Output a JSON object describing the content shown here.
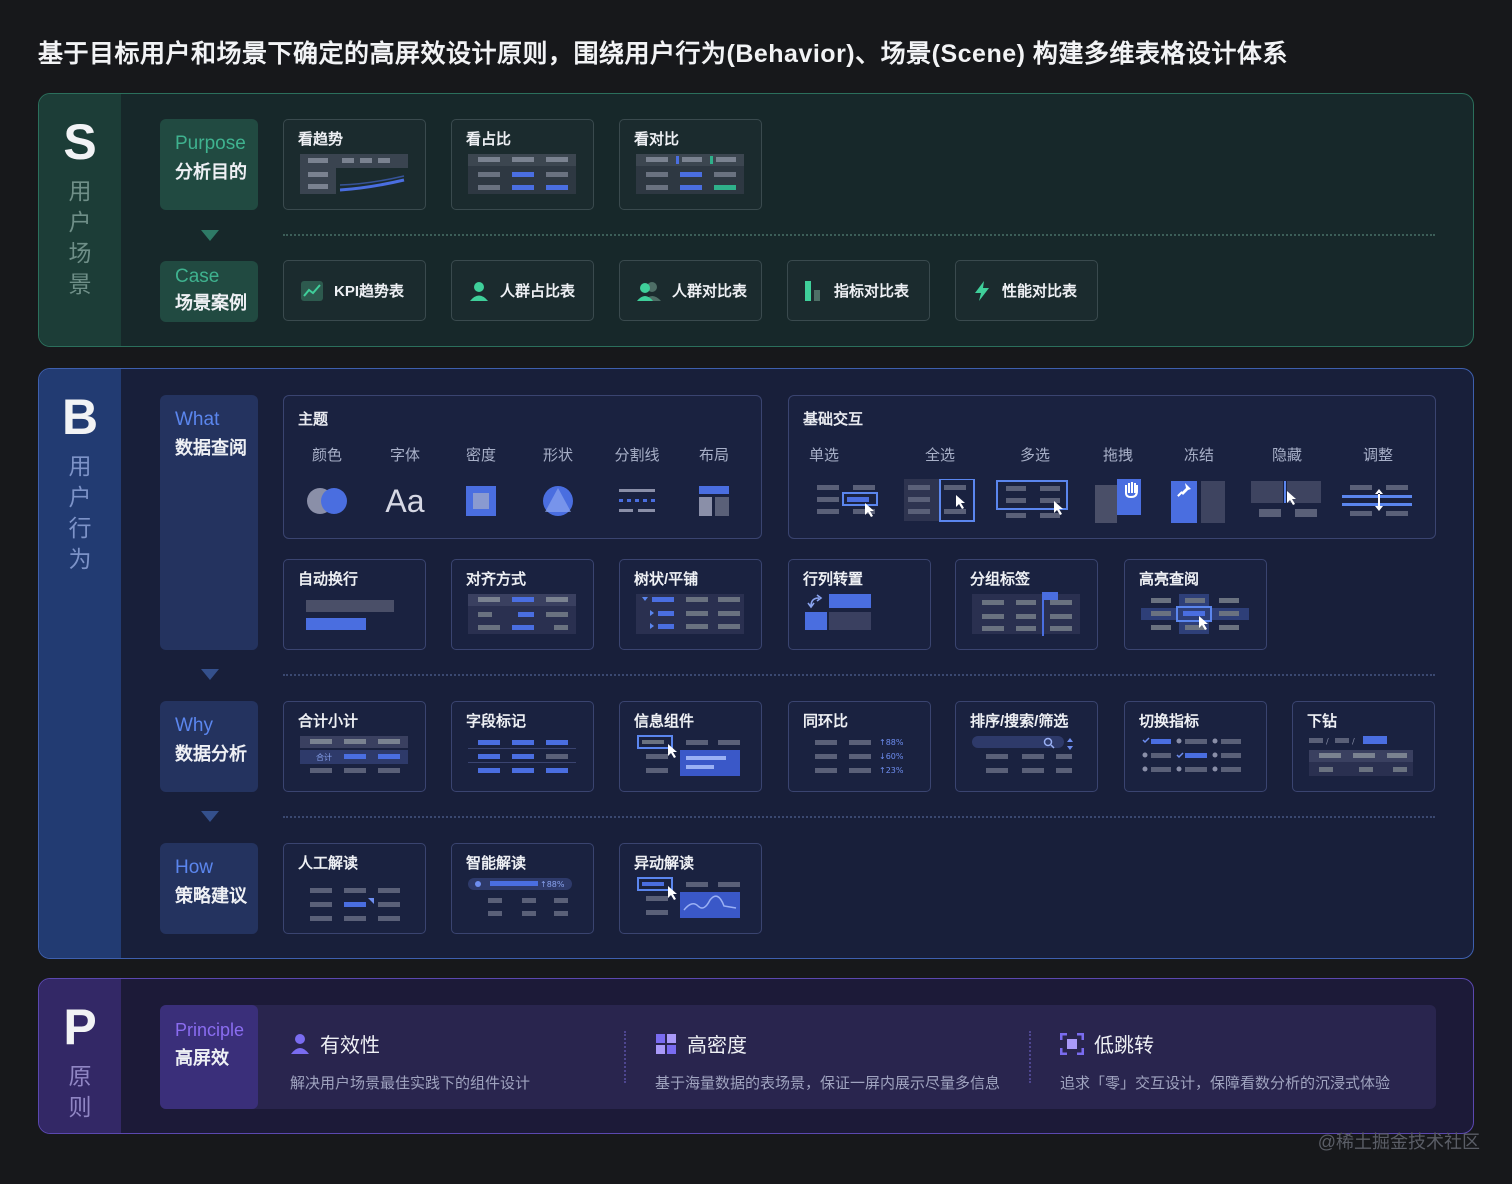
{
  "title": "基于目标用户和场景下确定的高屏效设计原则，围绕用户行为(Behavior)、场景(Scene) 构建多维表格设计体系",
  "colors": {
    "s_accent": "#2d9c7a",
    "b_accent": "#4a78e0",
    "p_accent": "#7a5ce0"
  },
  "s": {
    "letter": "S",
    "vlabel": "用户场景",
    "purpose": {
      "en": "Purpose",
      "cn": "分析目的"
    },
    "case": {
      "en": "Case",
      "cn": "场景案例"
    },
    "purpose_cards": [
      "看趋势",
      "看占比",
      "看对比"
    ],
    "cases": [
      {
        "label": "KPI趋势表",
        "icon": "trend-chart-icon"
      },
      {
        "label": "人群占比表",
        "icon": "person-icon"
      },
      {
        "label": "人群对比表",
        "icon": "people-icon"
      },
      {
        "label": "指标对比表",
        "icon": "bar-chart-icon"
      },
      {
        "label": "性能对比表",
        "icon": "lightning-icon"
      }
    ]
  },
  "b": {
    "letter": "B",
    "vlabel": "用户行为",
    "what": {
      "en": "What",
      "cn": "数据查阅"
    },
    "why": {
      "en": "Why",
      "cn": "数据分析"
    },
    "how": {
      "en": "How",
      "cn": "策略建议"
    },
    "theme": {
      "title": "主题",
      "items": [
        "颜色",
        "字体",
        "密度",
        "形状",
        "分割线",
        "布局"
      ],
      "font_sample": "Aa"
    },
    "interaction": {
      "title": "基础交互",
      "items": [
        "单选",
        "全选",
        "多选",
        "拖拽",
        "冻结",
        "隐藏",
        "调整"
      ]
    },
    "what_cards": [
      "自动换行",
      "对齐方式",
      "树状/平铺",
      "行列转置",
      "分组标签",
      "高亮查阅"
    ],
    "why_cards": [
      "合计小计",
      "字段标记",
      "信息组件",
      "同环比",
      "排序/搜索/筛选",
      "切换指标",
      "下钻"
    ],
    "how_cards": [
      "人工解读",
      "智能解读",
      "异动解读"
    ],
    "snippets": {
      "total": "合计",
      "pct1": "88%",
      "pct2": "60%",
      "pct3": "23%",
      "ai_pct": "88%"
    }
  },
  "p": {
    "letter": "P",
    "vlabel": "原则",
    "principle": {
      "en": "Principle",
      "cn": "高屏效"
    },
    "items": [
      {
        "title": "有效性",
        "desc": "解决用户场景最佳实践下的组件设计",
        "icon": "person-icon"
      },
      {
        "title": "高密度",
        "desc": "基于海量数据的表场景，保证一屏内展示尽量多信息",
        "icon": "grid-icon"
      },
      {
        "title": "低跳转",
        "desc": "追求「零」交互设计，保障看数分析的沉浸式体验",
        "icon": "focus-icon"
      }
    ]
  },
  "watermark": "@稀土掘金技术社区"
}
